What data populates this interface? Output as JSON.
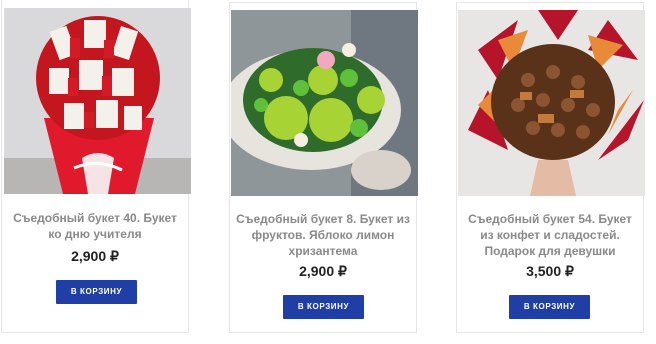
{
  "currency_symbol": "₽",
  "colors": {
    "button_bg": "#1f3fa6",
    "title_text": "#8a8a8a",
    "price_text": "#222222"
  },
  "products": [
    {
      "title": "Съедобный букет 40. Букет ко дню учителя",
      "price": "2,900 ₽",
      "button_label": "В КОРЗИНУ",
      "image": "bouquet-of-chocolate-bars-image"
    },
    {
      "title": "Съедобный букет 8. Букет из фруктов. Яблоко лимон хризантема",
      "price": "2,900 ₽",
      "button_label": "В КОРЗИНУ",
      "image": "bouquet-of-green-apples-image"
    },
    {
      "title": "Съедобный букет 54. Букет из конфет и сладостей. Подарок для девушки",
      "price": "3,500 ₽",
      "button_label": "В КОРЗИНУ",
      "image": "bouquet-of-chocolate-candies-image"
    }
  ]
}
